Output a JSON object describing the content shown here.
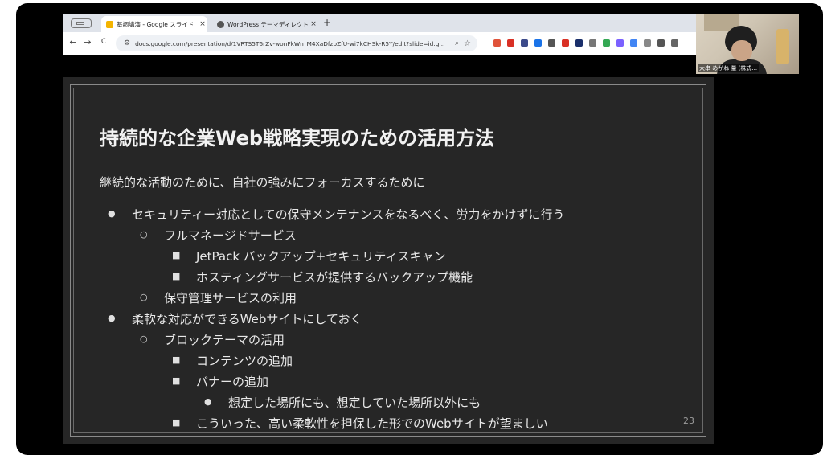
{
  "browser": {
    "tabs": [
      {
        "label": "基調講演 - Google スライド",
        "favicon_color": "#f4b400",
        "active": true
      },
      {
        "label": "WordPress テーマディレクトリ",
        "favicon_color": "#555555",
        "active": false
      }
    ],
    "new_tab": "+",
    "close_glyph": "×",
    "nav": {
      "back": "←",
      "forward": "→",
      "reload": "C"
    },
    "url": "docs.google.com/presentation/d/1VRTS5T6rZv-wonFkWn_M4XaDfzpZfU-wi7kCHSk-R5Y/edit?slide=id.g...",
    "extension_colors": [
      "#e0533a",
      "#d93025",
      "#3c4a8a",
      "#1a73e8",
      "#555555",
      "#d93025",
      "#1a2f6b",
      "#777777",
      "#34a853",
      "#7b61ff",
      "#4285f4",
      "#888888",
      "#555555",
      "#666666"
    ]
  },
  "slide": {
    "title": "持続的な企業Web戦略実現のための活用方法",
    "subtitle": "継続的な活動のために、自社の強みにフォーカスするために",
    "items": [
      {
        "text": "セキュリティー対応としての保守メンテナンスをなるべく、労力をかけずに行う",
        "marker": "●",
        "level": 1
      },
      {
        "text": "フルマネージドサービス",
        "marker": "○",
        "level": 2
      },
      {
        "text": "JetPack バックアップ+セキュリティスキャン",
        "marker": "■",
        "level": 3
      },
      {
        "text": "ホスティングサービスが提供するバックアップ機能",
        "marker": "■",
        "level": 3
      },
      {
        "text": "保守管理サービスの利用",
        "marker": "○",
        "level": 2
      },
      {
        "text": "柔軟な対応ができるWebサイトにしておく",
        "marker": "●",
        "level": 1
      },
      {
        "text": "ブロックテーマの活用",
        "marker": "○",
        "level": 2
      },
      {
        "text": "コンテンツの追加",
        "marker": "■",
        "level": 3
      },
      {
        "text": "バナーの追加",
        "marker": "■",
        "level": 3
      },
      {
        "text": "想定した場所にも、想定していた場所以外にも",
        "marker": "●",
        "level": 4
      },
      {
        "text": "こういった、高い柔軟性を担保した形でのWebサイトが望ましい",
        "marker": "■",
        "level": 3
      }
    ],
    "page_number": "23"
  },
  "webcam": {
    "name": "大串 めがね 量 (株式..."
  }
}
